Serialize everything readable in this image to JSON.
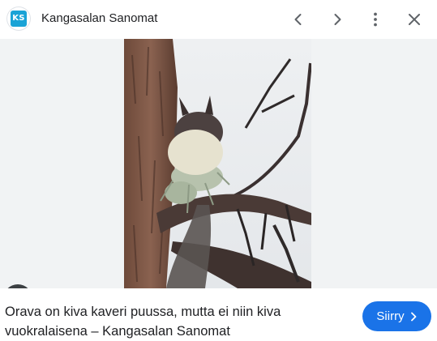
{
  "header": {
    "favicon_text": "KS",
    "site_name": "Kangasalan Sanomat",
    "icons": [
      "chevron-left-icon",
      "chevron-right-icon",
      "more-vert-icon",
      "close-icon"
    ]
  },
  "preview": {
    "lens_icon": "google-lens-icon"
  },
  "footer": {
    "caption": "Orava on kiva kaveri puussa, mutta ei niin kiva vuokralaisena – Kangasalan Sanomat",
    "visit_label": "Siirry",
    "visit_icon": "chevron-right-icon"
  },
  "colors": {
    "accent": "#1a73e8",
    "favicon_bg": "#1aa3d6",
    "image_bg": "#f1f3f4",
    "lens_bg": "#3c4043"
  }
}
